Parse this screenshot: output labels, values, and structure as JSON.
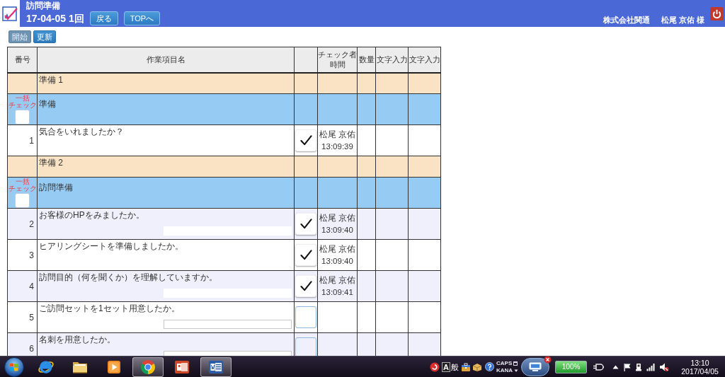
{
  "header": {
    "title": "訪問準備",
    "subtitle": "17-04-05 1回",
    "nav_buttons": [
      {
        "label": "戻る"
      },
      {
        "label": "TOPへ"
      }
    ],
    "company": "株式会社関通",
    "user": "松尾 京佑 様"
  },
  "toolbar": {
    "buttons": [
      {
        "label": "開始",
        "disabled": true
      },
      {
        "label": "更新",
        "disabled": false
      }
    ]
  },
  "table": {
    "columns": [
      {
        "label": "番号"
      },
      {
        "label": "作業項目名"
      },
      {},
      {
        "label": "チェック者時間"
      },
      {
        "label": "数量"
      },
      {
        "label": "文字入力"
      },
      {
        "label": "文字入力"
      }
    ],
    "rows": [
      {
        "kind": "group",
        "label": "準備 1"
      },
      {
        "kind": "section",
        "label": "準備",
        "bulk_label": "一括チェック",
        "checked": false
      },
      {
        "kind": "item",
        "number": "1",
        "label": "気合をいれましたか？",
        "checked": true,
        "checker": "松尾 京佑",
        "time": "13:09:39",
        "note_field": false
      },
      {
        "kind": "group",
        "label": "準備 2"
      },
      {
        "kind": "section",
        "label": "訪問準備",
        "bulk_label": "一括チェック",
        "checked": false
      },
      {
        "kind": "item",
        "number": "2",
        "label": "お客様のHPをみましたか。",
        "checked": true,
        "checker": "松尾 京佑",
        "time": "13:09:40",
        "note_field": true
      },
      {
        "kind": "item",
        "number": "3",
        "label": "ヒアリングシートを準備しましたか。",
        "checked": true,
        "checker": "松尾 京佑",
        "time": "13:09:40",
        "note_field": false
      },
      {
        "kind": "item",
        "number": "4",
        "label": "訪問目的（何を聞くか）を理解していますか。",
        "checked": true,
        "checker": "松尾 京佑",
        "time": "13:09:41",
        "note_field": true
      },
      {
        "kind": "item",
        "number": "5",
        "label": "ご訪問セットを1セット用意したか。",
        "checked": false,
        "note_field": true
      },
      {
        "kind": "item",
        "number": "6",
        "label": "名刺を用意したか。",
        "checked": false,
        "note_field": true
      }
    ]
  },
  "taskbar": {
    "apps": [
      {
        "kind": "e-globe",
        "selected": false
      },
      {
        "kind": "folder",
        "selected": false
      },
      {
        "kind": "player",
        "selected": false
      },
      {
        "kind": "ball",
        "selected": true
      },
      {
        "kind": "slides",
        "selected": false
      },
      {
        "kind": "document",
        "selected": true
      }
    ],
    "ime": {
      "mode": "A",
      "dictionary": "般"
    },
    "lock_keys": [
      "CAPS",
      "KANA"
    ],
    "battery": "100%",
    "clock": {
      "time": "13:10",
      "date": "2017/04/05"
    }
  }
}
